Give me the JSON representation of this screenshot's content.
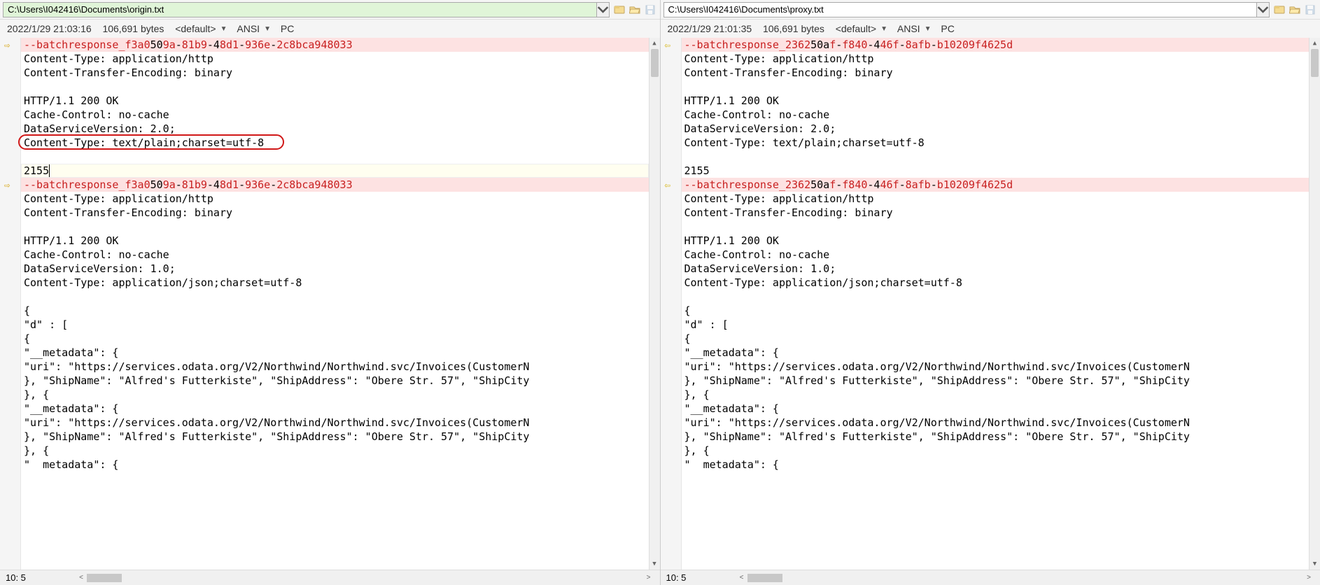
{
  "left": {
    "path": "C:\\Users\\I042416\\Documents\\origin.txt",
    "meta": {
      "datetime": "2022/1/29 21:03:16",
      "size": "106,691 bytes",
      "encoding_scope": "<default>",
      "charset": "ANSI",
      "lineend": "PC"
    },
    "lines": [
      {
        "type": "diff",
        "parts": [
          {
            "t": "--batchresponse_",
            "c": "red"
          },
          {
            "t": "f3a0",
            "c": "red"
          },
          {
            "t": "50",
            "c": "black"
          },
          {
            "t": "9a",
            "c": "red"
          },
          {
            "t": "-",
            "c": "black"
          },
          {
            "t": "81b9",
            "c": "red"
          },
          {
            "t": "-4",
            "c": "black"
          },
          {
            "t": "8d1",
            "c": "red"
          },
          {
            "t": "-",
            "c": "black"
          },
          {
            "t": "936e",
            "c": "red"
          },
          {
            "t": "-",
            "c": "black"
          },
          {
            "t": "2c8bca948033",
            "c": "red"
          }
        ]
      },
      {
        "type": "plain",
        "text": "Content-Type: application/http"
      },
      {
        "type": "plain",
        "text": "Content-Transfer-Encoding: binary"
      },
      {
        "type": "plain",
        "text": ""
      },
      {
        "type": "plain",
        "text": "HTTP/1.1 200 OK"
      },
      {
        "type": "plain",
        "text": "Cache-Control: no-cache"
      },
      {
        "type": "plain",
        "text": "DataServiceVersion: 2.0;"
      },
      {
        "type": "plain",
        "text": "Content-Type: text/plain;charset=utf-8"
      },
      {
        "type": "plain",
        "text": ""
      },
      {
        "type": "cursor",
        "text": "2155"
      },
      {
        "type": "diff",
        "parts": [
          {
            "t": "--batchresponse_",
            "c": "red"
          },
          {
            "t": "f3a0",
            "c": "red"
          },
          {
            "t": "50",
            "c": "black"
          },
          {
            "t": "9a",
            "c": "red"
          },
          {
            "t": "-",
            "c": "black"
          },
          {
            "t": "81b9",
            "c": "red"
          },
          {
            "t": "-4",
            "c": "black"
          },
          {
            "t": "8d1",
            "c": "red"
          },
          {
            "t": "-",
            "c": "black"
          },
          {
            "t": "936e",
            "c": "red"
          },
          {
            "t": "-",
            "c": "black"
          },
          {
            "t": "2c8bca948033",
            "c": "red"
          }
        ]
      },
      {
        "type": "plain",
        "text": "Content-Type: application/http"
      },
      {
        "type": "plain",
        "text": "Content-Transfer-Encoding: binary"
      },
      {
        "type": "plain",
        "text": ""
      },
      {
        "type": "plain",
        "text": "HTTP/1.1 200 OK"
      },
      {
        "type": "plain",
        "text": "Cache-Control: no-cache"
      },
      {
        "type": "plain",
        "text": "DataServiceVersion: 1.0;"
      },
      {
        "type": "plain",
        "text": "Content-Type: application/json;charset=utf-8"
      },
      {
        "type": "plain",
        "text": ""
      },
      {
        "type": "plain",
        "text": "{"
      },
      {
        "type": "plain",
        "text": "\"d\" : ["
      },
      {
        "type": "plain",
        "text": "{"
      },
      {
        "type": "plain",
        "text": "\"__metadata\": {"
      },
      {
        "type": "plain",
        "text": "\"uri\": \"https://services.odata.org/V2/Northwind/Northwind.svc/Invoices(CustomerN"
      },
      {
        "type": "plain",
        "text": "}, \"ShipName\": \"Alfred's Futterkiste\", \"ShipAddress\": \"Obere Str. 57\", \"ShipCity"
      },
      {
        "type": "plain",
        "text": "}, {"
      },
      {
        "type": "plain",
        "text": "\"__metadata\": {"
      },
      {
        "type": "plain",
        "text": "\"uri\": \"https://services.odata.org/V2/Northwind/Northwind.svc/Invoices(CustomerN"
      },
      {
        "type": "plain",
        "text": "}, \"ShipName\": \"Alfred's Futterkiste\", \"ShipAddress\": \"Obere Str. 57\", \"ShipCity"
      },
      {
        "type": "plain",
        "text": "}, {"
      },
      {
        "type": "plain",
        "text": "\"  metadata\": {"
      }
    ],
    "status_pos": "10: 5",
    "highlight_line_index": 7,
    "arrows": [
      {
        "line": 0,
        "dir": "right"
      },
      {
        "line": 10,
        "dir": "right"
      }
    ]
  },
  "right": {
    "path": "C:\\Users\\I042416\\Documents\\proxy.txt",
    "meta": {
      "datetime": "2022/1/29 21:01:35",
      "size": "106,691 bytes",
      "encoding_scope": "<default>",
      "charset": "ANSI",
      "lineend": "PC"
    },
    "lines": [
      {
        "type": "diff",
        "parts": [
          {
            "t": "--batchresponse_",
            "c": "red"
          },
          {
            "t": "2362",
            "c": "red"
          },
          {
            "t": "50a",
            "c": "black"
          },
          {
            "t": "f",
            "c": "red"
          },
          {
            "t": "-",
            "c": "black"
          },
          {
            "t": "f840",
            "c": "red"
          },
          {
            "t": "-4",
            "c": "black"
          },
          {
            "t": "46f",
            "c": "red"
          },
          {
            "t": "-",
            "c": "black"
          },
          {
            "t": "8afb",
            "c": "red"
          },
          {
            "t": "-",
            "c": "black"
          },
          {
            "t": "b10209f4625d",
            "c": "red"
          }
        ]
      },
      {
        "type": "plain",
        "text": "Content-Type: application/http"
      },
      {
        "type": "plain",
        "text": "Content-Transfer-Encoding: binary"
      },
      {
        "type": "plain",
        "text": ""
      },
      {
        "type": "plain",
        "text": "HTTP/1.1 200 OK"
      },
      {
        "type": "plain",
        "text": "Cache-Control: no-cache"
      },
      {
        "type": "plain",
        "text": "DataServiceVersion: 2.0;"
      },
      {
        "type": "plain",
        "text": "Content-Type: text/plain;charset=utf-8"
      },
      {
        "type": "plain",
        "text": ""
      },
      {
        "type": "plain",
        "text": "2155"
      },
      {
        "type": "diff",
        "parts": [
          {
            "t": "--batchresponse_",
            "c": "red"
          },
          {
            "t": "2362",
            "c": "red"
          },
          {
            "t": "50a",
            "c": "black"
          },
          {
            "t": "f",
            "c": "red"
          },
          {
            "t": "-",
            "c": "black"
          },
          {
            "t": "f840",
            "c": "red"
          },
          {
            "t": "-4",
            "c": "black"
          },
          {
            "t": "46f",
            "c": "red"
          },
          {
            "t": "-",
            "c": "black"
          },
          {
            "t": "8afb",
            "c": "red"
          },
          {
            "t": "-",
            "c": "black"
          },
          {
            "t": "b10209f4625d",
            "c": "red"
          }
        ]
      },
      {
        "type": "plain",
        "text": "Content-Type: application/http"
      },
      {
        "type": "plain",
        "text": "Content-Transfer-Encoding: binary"
      },
      {
        "type": "plain",
        "text": ""
      },
      {
        "type": "plain",
        "text": "HTTP/1.1 200 OK"
      },
      {
        "type": "plain",
        "text": "Cache-Control: no-cache"
      },
      {
        "type": "plain",
        "text": "DataServiceVersion: 1.0;"
      },
      {
        "type": "plain",
        "text": "Content-Type: application/json;charset=utf-8"
      },
      {
        "type": "plain",
        "text": ""
      },
      {
        "type": "plain",
        "text": "{"
      },
      {
        "type": "plain",
        "text": "\"d\" : ["
      },
      {
        "type": "plain",
        "text": "{"
      },
      {
        "type": "plain",
        "text": "\"__metadata\": {"
      },
      {
        "type": "plain",
        "text": "\"uri\": \"https://services.odata.org/V2/Northwind/Northwind.svc/Invoices(CustomerN"
      },
      {
        "type": "plain",
        "text": "}, \"ShipName\": \"Alfred's Futterkiste\", \"ShipAddress\": \"Obere Str. 57\", \"ShipCity"
      },
      {
        "type": "plain",
        "text": "}, {"
      },
      {
        "type": "plain",
        "text": "\"__metadata\": {"
      },
      {
        "type": "plain",
        "text": "\"uri\": \"https://services.odata.org/V2/Northwind/Northwind.svc/Invoices(CustomerN"
      },
      {
        "type": "plain",
        "text": "}, \"ShipName\": \"Alfred's Futterkiste\", \"ShipAddress\": \"Obere Str. 57\", \"ShipCity"
      },
      {
        "type": "plain",
        "text": "}, {"
      },
      {
        "type": "plain",
        "text": "\"  metadata\": {"
      }
    ],
    "status_pos": "10: 5",
    "arrows": [
      {
        "line": 0,
        "dir": "left"
      },
      {
        "line": 10,
        "dir": "left"
      }
    ]
  }
}
